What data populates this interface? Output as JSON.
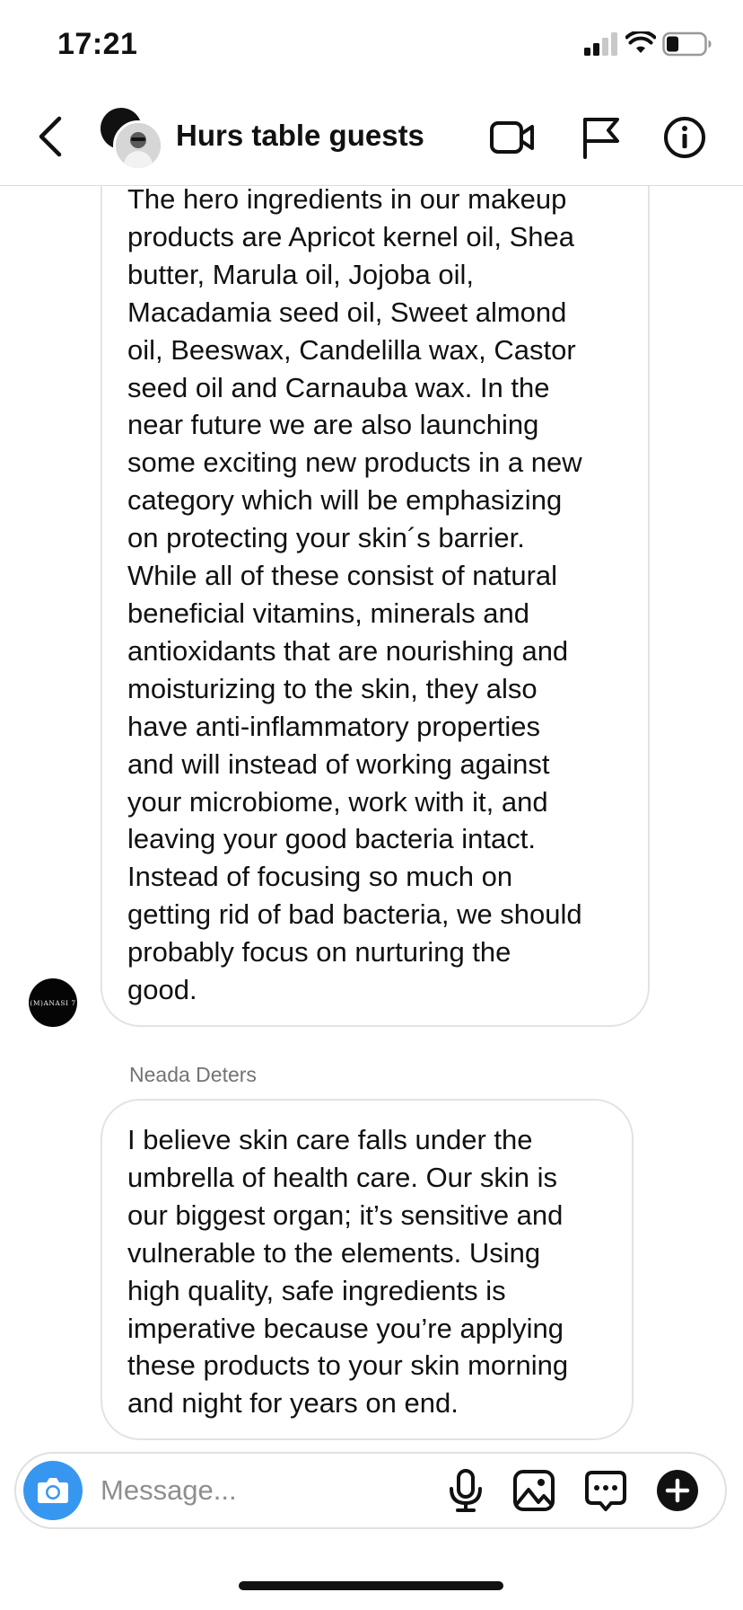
{
  "status_bar": {
    "time": "17:21",
    "icons": [
      "cellular-signal-icon",
      "wifi-icon",
      "battery-icon"
    ]
  },
  "header": {
    "title": "Hurs table guests",
    "icons": [
      "back-chevron-icon",
      "video-call-icon",
      "flag-icon",
      "info-icon"
    ]
  },
  "messages": [
    {
      "sender_avatar_text": "(M)ANASI 7",
      "text": "The hero ingredients in our makeup\nproducts are Apricot kernel oil, Shea\nbutter, Marula oil, Jojoba oil,\nMacadamia seed oil, Sweet almond\noil, Beeswax, Candelilla wax, Castor\nseed oil and Carnauba wax. In the\nnear future we are also launching\nsome exciting new products in a new\ncategory which will be emphasizing\non protecting your skin´s barrier.\nWhile all of these consist of natural\nbeneficial vitamins, minerals and\nantioxidants that are nourishing and\nmoisturizing to the skin, they also\nhave anti-inflammatory properties\nand will instead of working against\nyour microbiome, work with it, and\nleaving your good bacteria intact.\nInstead of focusing so much on\ngetting rid of bad bacteria, we should\nprobably focus on nurturing the\ngood."
    },
    {
      "sender_name": "Neada Deters",
      "text": "I believe skin care falls under the\numbrella of health care. Our skin is\nour biggest organ; it’s sensitive and\nvulnerable to the elements. Using\nhigh quality, safe ingredients is\nimperative because you’re applying\nthese products to your skin morning\nand night for years on end."
    }
  ],
  "composer": {
    "placeholder": "Message...",
    "value": "",
    "icons": [
      "camera-icon",
      "microphone-icon",
      "gallery-icon",
      "sticker-icon",
      "plus-icon"
    ]
  },
  "colors": {
    "accent": "#3797f0",
    "bubble_border": "#e3e3e3",
    "secondary_text": "#737373"
  }
}
